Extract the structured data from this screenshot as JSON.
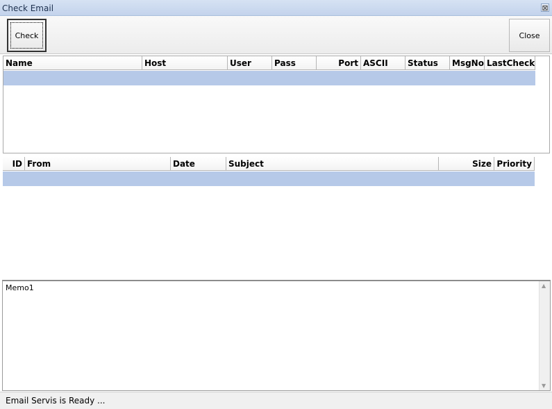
{
  "window": {
    "title": "Check Email",
    "close_glyph": "⊠"
  },
  "toolbar": {
    "check_label": "Check",
    "close_label": "Close"
  },
  "accounts_grid": {
    "columns": [
      "Name",
      "Host",
      "User",
      "Pass",
      "Port",
      "ASCII",
      "Status",
      "MsgNo",
      "LastCheck"
    ]
  },
  "messages_grid": {
    "columns": [
      "ID",
      "From",
      "Date",
      "Subject",
      "Size",
      "Priority"
    ]
  },
  "memo": {
    "text": "Memo1"
  },
  "status": {
    "text": "Email Servis is Ready ..."
  },
  "colors": {
    "selection": "#b6c9e8",
    "titlebar": "#c3d3ec"
  }
}
